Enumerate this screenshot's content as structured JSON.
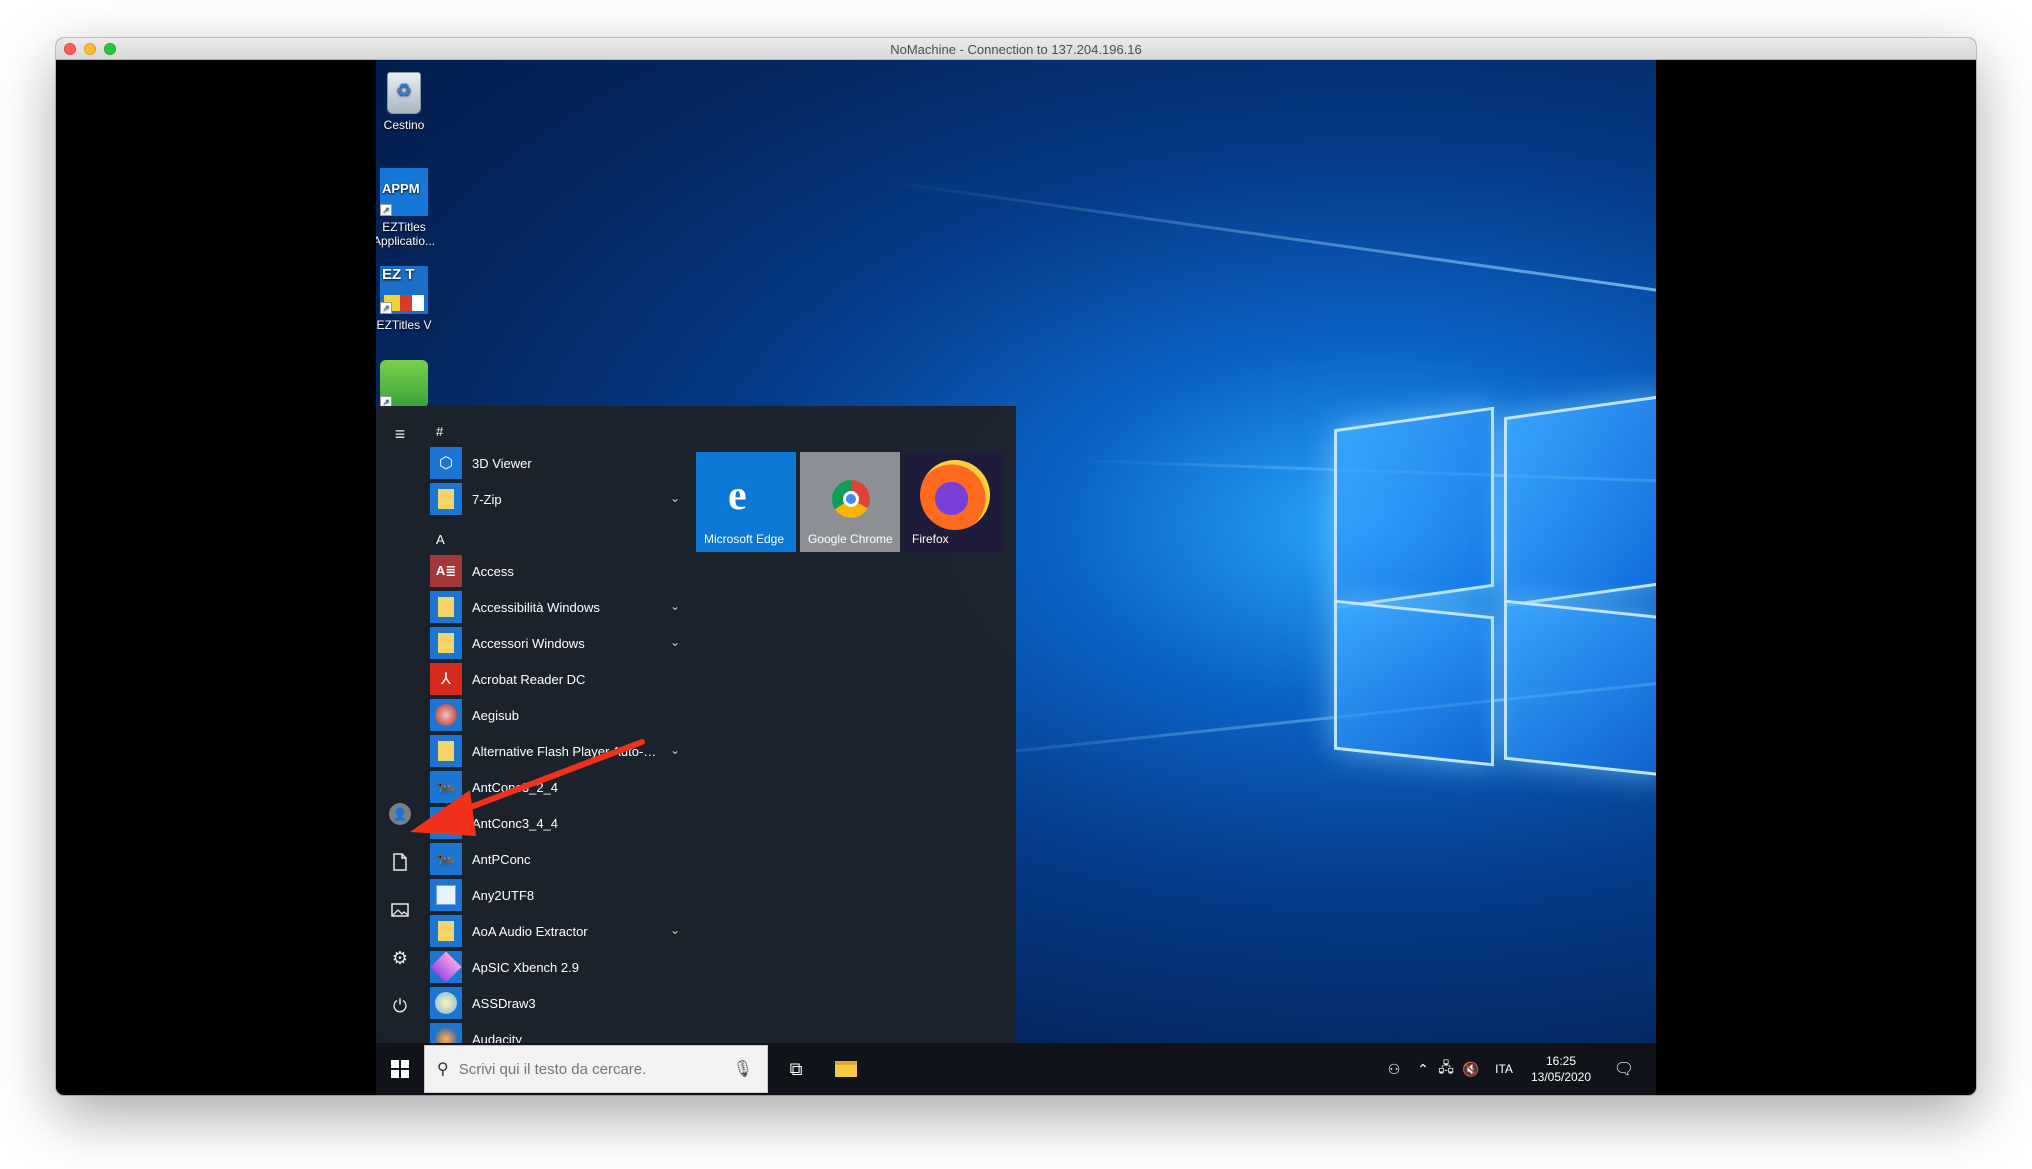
{
  "window": {
    "title": "NoMachine - Connection to 137.204.196.16"
  },
  "desktop": {
    "icons": [
      {
        "name": "recycle-bin",
        "label": "Cestino"
      },
      {
        "name": "eztitles-app",
        "label": "EZTitles Applicatio..."
      },
      {
        "name": "eztitles-v",
        "label": "EZTitles V"
      },
      {
        "name": "green-app",
        "label": ""
      }
    ]
  },
  "start_menu": {
    "rail": {
      "menu_icon": "hamburger-icon",
      "user_icon": "user-avatar-icon",
      "documents_icon": "document-icon",
      "pictures_icon": "pictures-icon",
      "settings_icon": "gear-icon",
      "power_icon": "power-icon"
    },
    "letters": [
      "#",
      "A"
    ],
    "apps": [
      {
        "label": "3D Viewer",
        "icon": "cube-icon",
        "color": "#1a76d2",
        "group": false
      },
      {
        "label": "7-Zip",
        "icon": "folder-icon",
        "color": "#f7c948",
        "group": true
      },
      {
        "label": "Access",
        "icon": "access-icon",
        "color": "#a4373a",
        "group": false
      },
      {
        "label": "Accessibilità Windows",
        "icon": "folder-icon",
        "color": "#f7c948",
        "group": true
      },
      {
        "label": "Accessori Windows",
        "icon": "folder-icon",
        "color": "#f7c948",
        "group": true
      },
      {
        "label": "Acrobat Reader DC",
        "icon": "acrobat-icon",
        "color": "#d52b1e",
        "group": false
      },
      {
        "label": "Aegisub",
        "icon": "aegisub-icon",
        "color": "#b3261e",
        "group": false
      },
      {
        "label": "Alternative Flash Player Auto-Up...",
        "icon": "folder-icon",
        "color": "#f7c948",
        "group": true
      },
      {
        "label": "AntConc3_2_4",
        "icon": "antconc-icon",
        "color": "#1a76d2",
        "group": false
      },
      {
        "label": "AntConc3_4_4",
        "icon": "antconc-icon",
        "color": "#1a76d2",
        "group": false
      },
      {
        "label": "AntPConc",
        "icon": "antpconc-icon",
        "color": "#1a76d2",
        "group": false
      },
      {
        "label": "Any2UTF8",
        "icon": "any2utf8-icon",
        "color": "#1a76d2",
        "group": false
      },
      {
        "label": "AoA Audio Extractor",
        "icon": "folder-icon",
        "color": "#f7c948",
        "group": true
      },
      {
        "label": "ApSIC Xbench 2.9",
        "icon": "xbench-icon",
        "color": "#1a76d2",
        "group": false
      },
      {
        "label": "ASSDraw3",
        "icon": "assdraw-icon",
        "color": "#1a76d2",
        "group": false
      },
      {
        "label": "Audacity",
        "icon": "audacity-icon",
        "color": "#1a76d2",
        "group": false
      }
    ],
    "tiles": [
      {
        "label": "Microsoft Edge",
        "icon": "edge-icon",
        "bg": "#0a78d4"
      },
      {
        "label": "Google Chrome",
        "icon": "chrome-icon",
        "bg": "#8c9096"
      },
      {
        "label": "Firefox",
        "icon": "firefox-icon",
        "bg": "#1f1b3a"
      }
    ]
  },
  "taskbar": {
    "start_icon": "windows-logo-icon",
    "search_placeholder": "Scrivi qui il testo da cercare.",
    "search_icon": "search-icon",
    "mic_icon": "microphone-icon",
    "taskview_icon": "task-view-icon",
    "explorer_icon": "file-explorer-icon",
    "tray": {
      "people_icon": "people-icon",
      "chevron_icon": "chevron-up-icon",
      "network_icon": "network-icon",
      "volume_icon": "volume-muted-icon",
      "language": "ITA",
      "time": "16:25",
      "date": "13/05/2020",
      "notification_icon": "notification-icon"
    }
  },
  "annotation": {
    "arrow_color": "#f2311c"
  }
}
